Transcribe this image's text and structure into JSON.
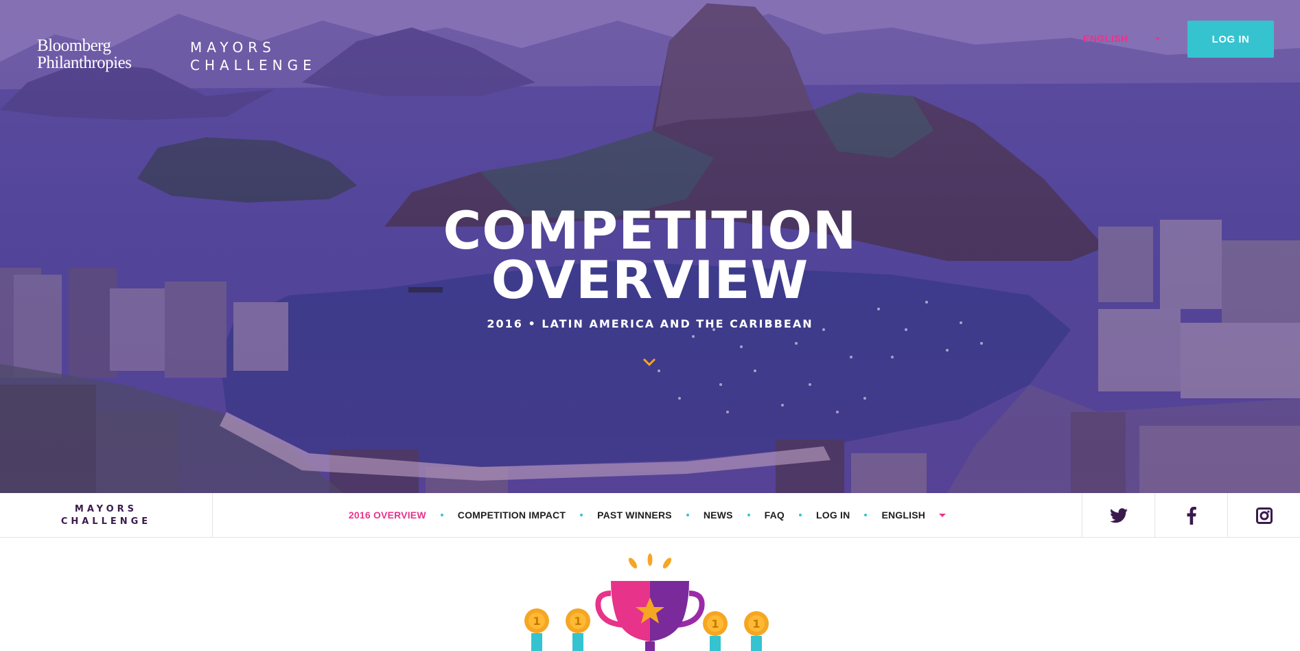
{
  "header": {
    "brand_primary_line1": "Bloomberg",
    "brand_primary_line2": "Philanthropies",
    "brand_secondary_line1": "MAYORS",
    "brand_secondary_line2": "CHALLENGE",
    "language_label": "ENGLISH",
    "login_label": "LOG IN"
  },
  "hero": {
    "title_line1": "COMPETITION",
    "title_line2": "OVERVIEW",
    "subtitle": "2016 • LATIN AMERICA AND THE CARIBBEAN"
  },
  "nav": {
    "logo_line1": "MAYORS",
    "logo_line2": "CHALLENGE",
    "items": [
      {
        "label": "2016 OVERVIEW",
        "active": true
      },
      {
        "label": "COMPETITION IMPACT"
      },
      {
        "label": "PAST WINNERS"
      },
      {
        "label": "NEWS"
      },
      {
        "label": "FAQ"
      },
      {
        "label": "LOG IN"
      },
      {
        "label": "ENGLISH"
      }
    ],
    "social": [
      "twitter-icon",
      "facebook-icon",
      "instagram-icon"
    ]
  },
  "colors": {
    "accent_pink": "#e8338a",
    "accent_teal": "#35c3d0",
    "brand_purple": "#3a1a4d",
    "medal_orange": "#f5a623"
  }
}
